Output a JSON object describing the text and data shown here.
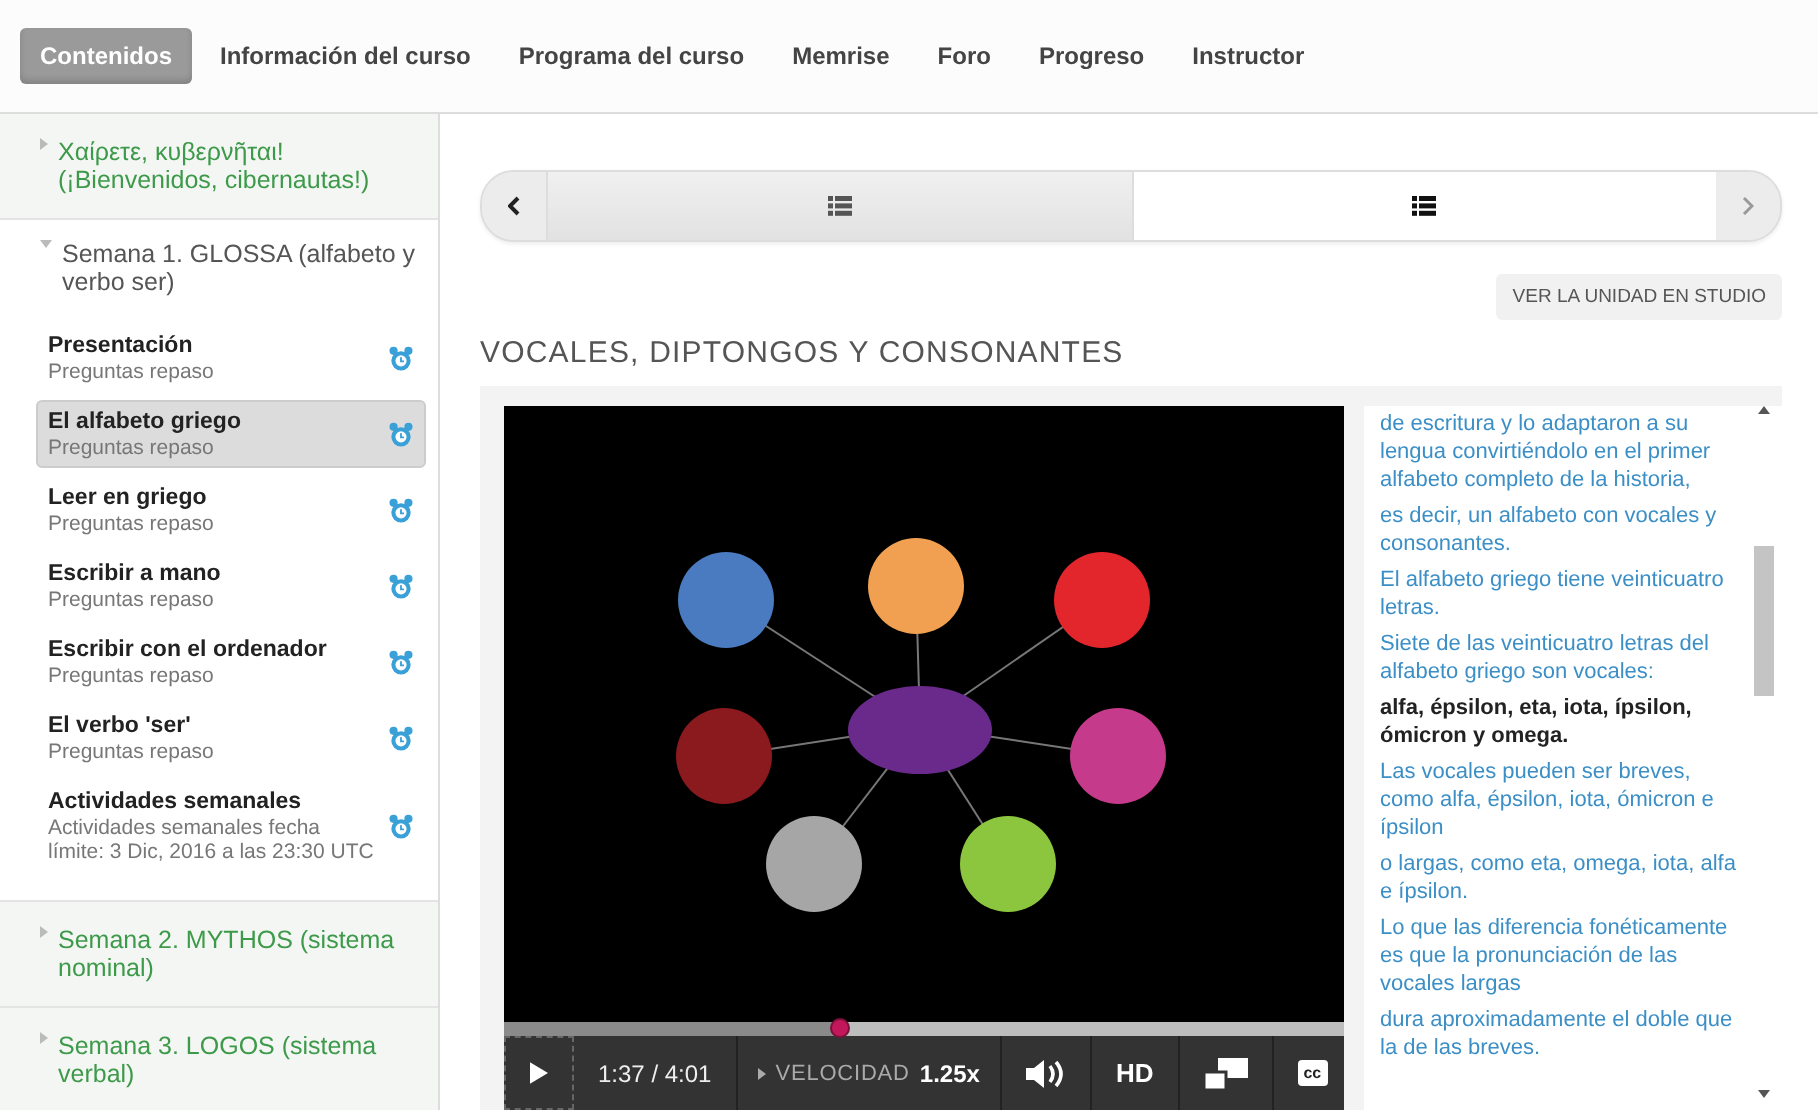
{
  "nav": {
    "tabs": [
      {
        "label": "Contenidos",
        "selected": true
      },
      {
        "label": "Información del curso",
        "selected": false
      },
      {
        "label": "Programa del curso",
        "selected": false
      },
      {
        "label": "Memrise",
        "selected": false
      },
      {
        "label": "Foro",
        "selected": false
      },
      {
        "label": "Progreso",
        "selected": false
      },
      {
        "label": "Instructor",
        "selected": false
      }
    ]
  },
  "sidebar": {
    "sections": [
      {
        "title": "Χαίρετε, κυβερνῆται! (¡Bienvenidos, cibernautas!)",
        "expanded": false
      },
      {
        "title": "Semana 1. GLOSSA (alfabeto y verbo ser)",
        "expanded": true,
        "items": [
          {
            "title": "Presentación",
            "subtitle": "Preguntas repaso",
            "selected": false
          },
          {
            "title": "El alfabeto griego",
            "subtitle": "Preguntas repaso",
            "selected": true
          },
          {
            "title": "Leer en griego",
            "subtitle": "Preguntas repaso",
            "selected": false
          },
          {
            "title": "Escribir a mano",
            "subtitle": "Preguntas repaso",
            "selected": false
          },
          {
            "title": "Escribir con el ordenador",
            "subtitle": "Preguntas repaso",
            "selected": false
          },
          {
            "title": "El verbo 'ser'",
            "subtitle": "Preguntas repaso",
            "selected": false
          },
          {
            "title": "Actividades semanales",
            "subtitle": "Actividades semanales fecha límite: 3 Dic, 2016 a las 23:30 UTC",
            "selected": false
          }
        ]
      },
      {
        "title": "Semana 2. MYTHOS (sistema nominal)",
        "expanded": false
      },
      {
        "title": "Semana 3. LOGOS (sistema verbal)",
        "expanded": false
      }
    ]
  },
  "main": {
    "carousel": {
      "units": [
        {
          "selected": false
        },
        {
          "selected": true
        }
      ]
    },
    "studio_button": "VER LA UNIDAD EN STUDIO",
    "heading": "VOCALES, DIPTONGOS Y CONSONANTES",
    "video": {
      "progress": {
        "level": 0.4
      },
      "time": "1:37 / 4:01",
      "speed_label": "VELOCIDAD",
      "speed": "1.25x",
      "hd": "HD",
      "cc": "cc"
    },
    "transcript": [
      {
        "text": "de escritura y lo adaptaron a su lengua convirtiéndolo en el primer alfabeto completo de la historia,",
        "current": false
      },
      {
        "text": "es decir, un alfabeto con vocales y consonantes.",
        "current": false
      },
      {
        "text": "El alfabeto griego tiene veinticuatro letras.",
        "current": false
      },
      {
        "text": "Siete de las veinticuatro letras del alfabeto griego son vocales:",
        "current": false
      },
      {
        "text": "alfa, épsilon, eta, iota, ípsilon, ómicron y omega.",
        "current": true
      },
      {
        "text": "Las vocales pueden ser breves, como alfa, épsilon, iota, ómicron e ípsilon",
        "current": false
      },
      {
        "text": "o largas, como eta, omega, iota, alfa e ípsilon.",
        "current": false
      },
      {
        "text": "Lo que las diferencia fonéticamente es que la pronunciación de las vocales largas",
        "current": false
      },
      {
        "text": "dura aproximadamente el doble que la de las breves.",
        "current": false
      }
    ]
  }
}
